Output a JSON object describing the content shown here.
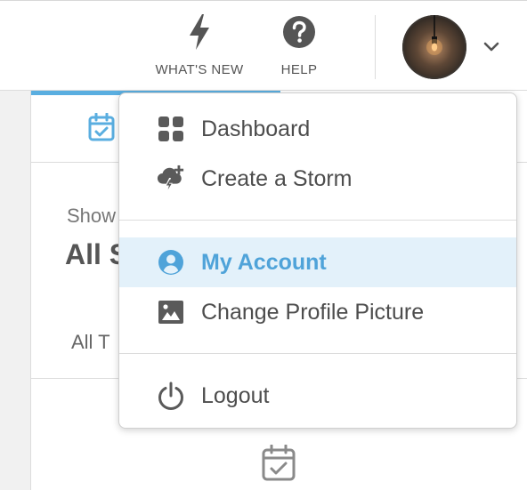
{
  "header": {
    "whats_new_label": "WHAT'S NEW",
    "help_label": "HELP"
  },
  "page": {
    "show_label": "Show",
    "title_partial": "All S",
    "tab_label_partial": "All T"
  },
  "menu": {
    "items": [
      {
        "label": "Dashboard",
        "icon": "dashboard-grid-icon"
      },
      {
        "label": "Create a Storm",
        "icon": "storm-cloud-plus-icon"
      },
      {
        "label": "My Account",
        "icon": "account-circle-icon",
        "selected": true
      },
      {
        "label": "Change Profile Picture",
        "icon": "image-icon"
      },
      {
        "label": "Logout",
        "icon": "power-icon"
      }
    ]
  },
  "colors": {
    "accent": "#5aaee0",
    "selected_bg": "#e3f1fa",
    "selected_text": "#4fa3d9",
    "icon_gray": "#5a5a5a"
  }
}
